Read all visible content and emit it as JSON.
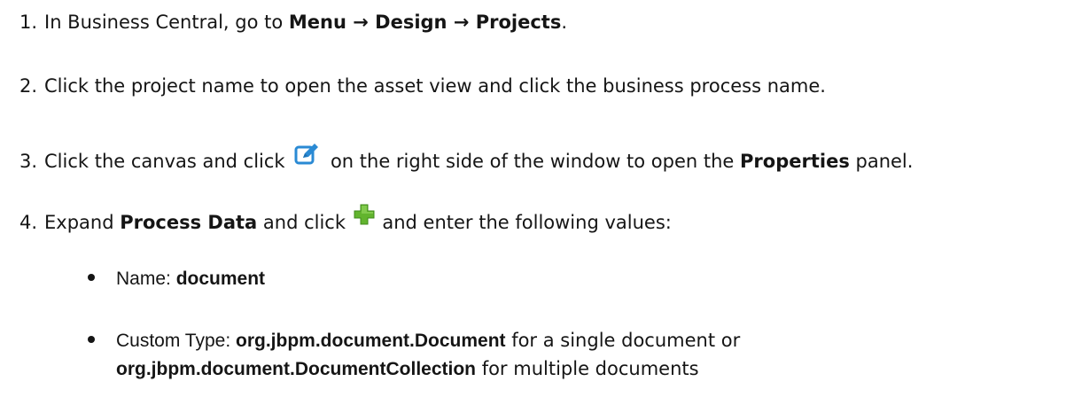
{
  "steps": [
    {
      "number": "1.",
      "intro": "In Business Central, go to ",
      "menu_path": "Menu → Design → Projects",
      "end": "."
    },
    {
      "number": "2.",
      "text": "Click the project name to open the asset view and click the business process name."
    },
    {
      "number": "3.",
      "before_icon": "Click the canvas and click ",
      "icon": "edit-icon",
      "after_icon": " on the right side of the window to open the ",
      "properties": "Properties",
      "end": " panel."
    },
    {
      "number": "4.",
      "expand": "Expand ",
      "process_data": "Process Data",
      "click": " and click ",
      "icon": "add-icon",
      "after_icon": " and enter the following values:"
    }
  ],
  "bullets": [
    {
      "label": "Name",
      "sep": ": ",
      "value": "document"
    },
    {
      "label": "Custom Type",
      "sep": ": ",
      "value": "org.jbpm.document.Document",
      "middle": " for a single document or",
      "value2": "org.jbpm.document.DocumentCollection",
      "end": " for multiple documents"
    }
  ],
  "colors": {
    "text": "#151515",
    "edit_icon": "#2a8ad4",
    "add_icon": "#62b42e"
  }
}
